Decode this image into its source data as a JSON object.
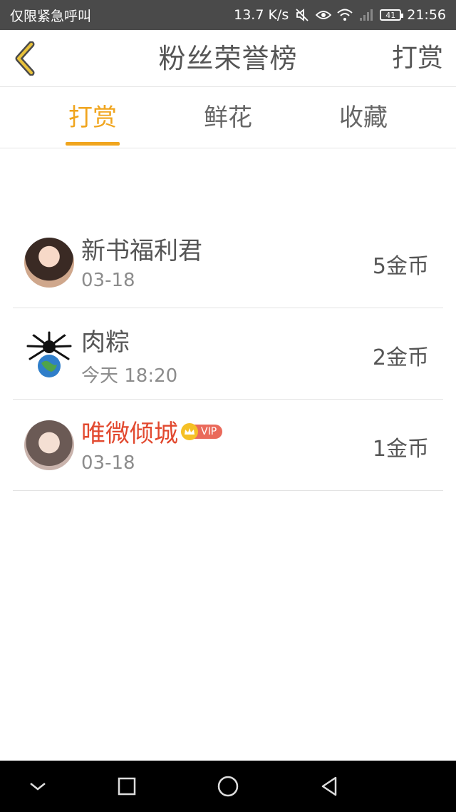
{
  "status_bar": {
    "carrier_text": "仅限紧急呼叫",
    "speed": "13.7 K/s",
    "battery": "41",
    "time": "21:56",
    "icons": [
      "mute-icon",
      "eye-icon",
      "wifi-icon",
      "signal-icon",
      "battery-icon"
    ]
  },
  "header": {
    "title": "粉丝荣誉榜",
    "right_label": "打赏",
    "back_icon": "chevron-left-icon"
  },
  "tabs": [
    {
      "label": "打赏",
      "active": true
    },
    {
      "label": "鲜花",
      "active": false
    },
    {
      "label": "收藏",
      "active": false
    }
  ],
  "fans": [
    {
      "name": "新书福利君",
      "date": "03-18",
      "amount": "5金币",
      "vip": false
    },
    {
      "name": "肉粽",
      "date": "今天 18:20",
      "amount": "2金币",
      "vip": false
    },
    {
      "name": "唯微倾城",
      "date": "03-18",
      "amount": "1金币",
      "vip": true,
      "vip_label": "VIP"
    }
  ],
  "colors": {
    "accent": "#f0a51e",
    "vip_name": "#e2492f",
    "text": "#555555",
    "status_bar": "#4a4a4a"
  },
  "system_nav": [
    "chevron-down-icon",
    "square-icon",
    "circle-icon",
    "triangle-back-icon"
  ]
}
